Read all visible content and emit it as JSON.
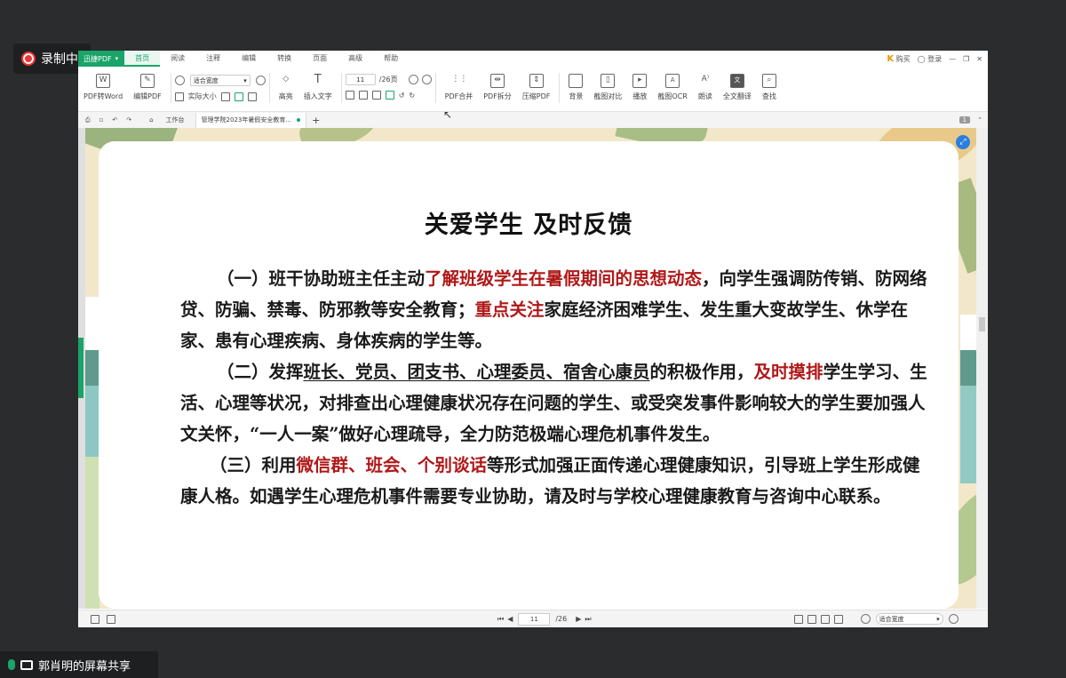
{
  "recording": {
    "label": "录制中"
  },
  "app": {
    "brand": "迅捷PDF",
    "menu_tabs": [
      "首页",
      "阅读",
      "注释",
      "编辑",
      "转换",
      "页面",
      "高级",
      "帮助"
    ],
    "window_controls": {
      "buy": "购买",
      "login": "登录"
    },
    "ribbon": {
      "pdf_to_word": "PDF转Word",
      "edit_pdf": "编辑PDF",
      "fit_select": "适合宽度",
      "actual_size": "实际大小",
      "page_input": "11",
      "page_total": "/26页",
      "highlight": "高亮",
      "insert_text": "插入文字",
      "merge": "PDF合并",
      "split": "PDF拆分",
      "compress": "压缩PDF",
      "background": "背景",
      "compare": "截图对比",
      "play": "播放",
      "ocr": "截图OCR",
      "read_aloud": "朗读",
      "translate": "全文翻译",
      "find": "查找"
    },
    "doc_tabs": {
      "workspace": "工作台",
      "document": "管理学院2023年暑假安全教育...",
      "page_badge": "1"
    },
    "status": {
      "page_input": "11",
      "page_total": "/26",
      "fit": "适合宽度"
    }
  },
  "document": {
    "title": "关爱学生 及时反馈",
    "p1": {
      "a": "（一）班干协助班主任主动",
      "b": "了解班级学生在暑假期间的思想动态",
      "c": "，向学生强调防传销、防网络贷、防骗、禁毒、防邪教等安全教育；",
      "d": "重点关注",
      "e": "家庭经济困难学生、发生重大变故学生、休学在家、患有心理疾病、身体疾病的学生等。"
    },
    "p2": {
      "a": "（二）发挥",
      "b": "班长、党员、团支书、心理委员、宿舍心康员",
      "c": "的积极作用，",
      "d": "及时摸排",
      "e": "学生学习、生活、心理等状况，对排查出心理健康状况存在问题的学生、或受突发事件影响较大的学生要加强人文关怀，“一人一案”做好心理疏导，全力防范极端心理危机事件发生。"
    },
    "p3": {
      "a": "（三）利用",
      "b": "微信群、班会、个别谈话",
      "c": "等形式加强正面传递心理健康知识，引导班上学生形成健康人格。如遇学生心理危机事件需要专业协助，请及时与学校心理健康教育与咨询中心联系。"
    }
  },
  "share": {
    "label": "郭肖明的屏幕共享"
  },
  "colors": {
    "accent": "#1aa468",
    "emphasis": "#b01818"
  }
}
